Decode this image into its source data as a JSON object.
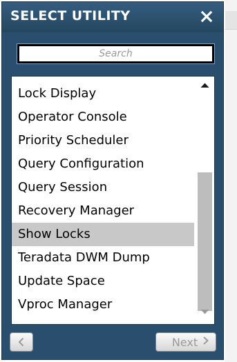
{
  "panel": {
    "title": "SELECT UTILITY",
    "close_icon": "close-icon"
  },
  "search": {
    "placeholder": "Search",
    "value": ""
  },
  "list": {
    "items": [
      {
        "label": "Lock Display",
        "selected": false
      },
      {
        "label": "Operator Console",
        "selected": false
      },
      {
        "label": "Priority Scheduler",
        "selected": false
      },
      {
        "label": "Query Configuration",
        "selected": false
      },
      {
        "label": "Query Session",
        "selected": false
      },
      {
        "label": "Recovery Manager",
        "selected": false
      },
      {
        "label": "Show Locks",
        "selected": true
      },
      {
        "label": "Teradata DWM Dump",
        "selected": false
      },
      {
        "label": "Update Space",
        "selected": false
      },
      {
        "label": "Vproc Manager",
        "selected": false
      }
    ]
  },
  "footer": {
    "prev_icon": "chevron-left-icon",
    "next_label": "Next",
    "next_icon": "chevron-right-icon"
  },
  "colors": {
    "panel_bg": "#2a4f6e",
    "title_text": "#ffffff",
    "selected_row": "#c8c8c8",
    "scroll_thumb": "#bdbdbd",
    "disabled_text": "#9a9a9a"
  }
}
